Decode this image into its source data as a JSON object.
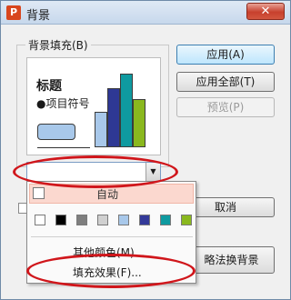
{
  "window": {
    "title": "背景",
    "app_icon_letter": "P",
    "close_glyph": "✕"
  },
  "group": {
    "label": "背景填充(B)"
  },
  "preview": {
    "title": "标题",
    "bullet": "●项目符号"
  },
  "buttons": {
    "apply": "应用(A)",
    "apply_all": "应用全部(T)",
    "preview": "预览(P)",
    "cancel": "取消",
    "ignore_master": "略法换背景"
  },
  "combo": {
    "arrow": "▼"
  },
  "popup": {
    "auto_label": "自动",
    "swatches": [
      "#ffffff",
      "#000000",
      "#7f7f7f",
      "#d0d0d0",
      "#a8c8ea",
      "#333a99",
      "#0f9aa0",
      "#8ab81e"
    ],
    "more_colors": "其他颜色(M)...",
    "fill_effects": "填充效果(F)..."
  },
  "colors": {
    "annotation": "#d0161b",
    "bar_light": "#a8c8ea",
    "bar_navy": "#2e3894",
    "bar_teal": "#0f9aa0",
    "bar_green": "#8ab81e"
  }
}
